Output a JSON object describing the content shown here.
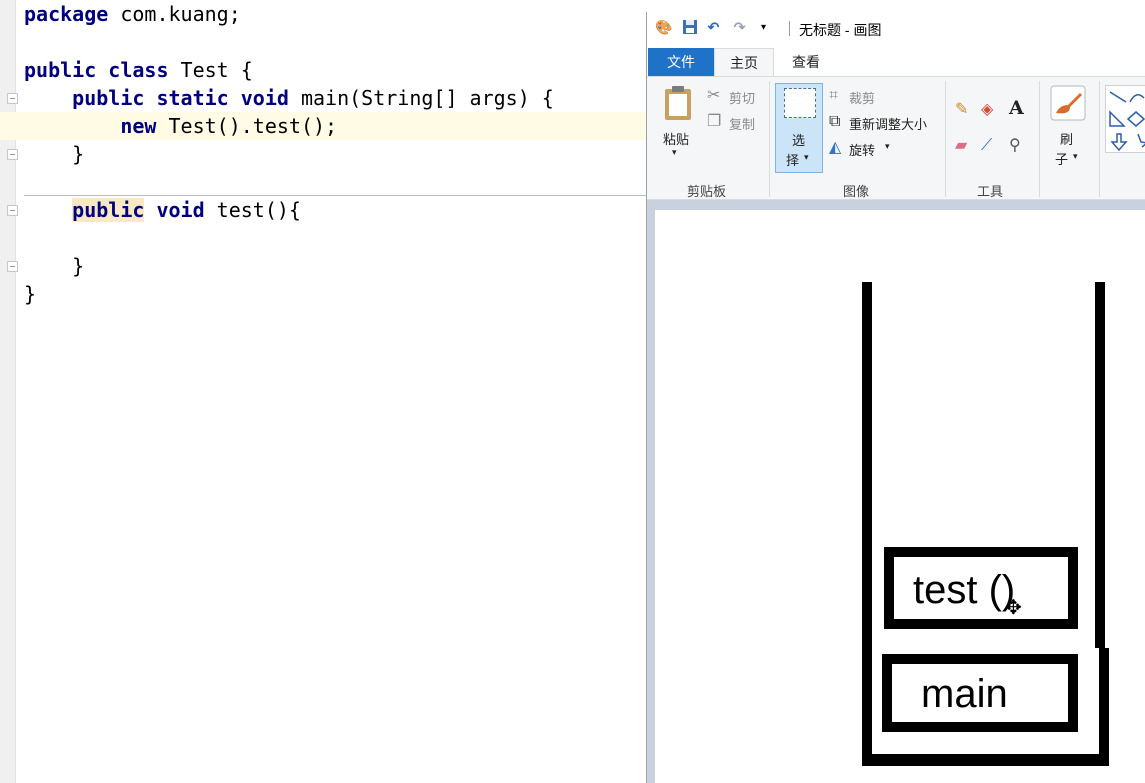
{
  "editor": {
    "lines": [
      [
        {
          "t": "package",
          "k": true
        },
        {
          "t": " com.kuang;"
        }
      ],
      [],
      [
        {
          "t": "public",
          "k": true
        },
        {
          "t": " "
        },
        {
          "t": "class",
          "k": true
        },
        {
          "t": " Test {"
        }
      ],
      [
        {
          "t": "    "
        },
        {
          "t": "public",
          "k": true
        },
        {
          "t": " "
        },
        {
          "t": "static",
          "k": true
        },
        {
          "t": " "
        },
        {
          "t": "void",
          "k": true
        },
        {
          "t": " main(String[] args) {"
        }
      ],
      [
        {
          "t": "        "
        },
        {
          "t": "new",
          "k": true
        },
        {
          "t": " Test().test();"
        }
      ],
      [
        {
          "t": "    }"
        }
      ],
      [],
      [
        {
          "t": "    "
        },
        {
          "t": "public",
          "k": true,
          "h": true
        },
        {
          "t": " "
        },
        {
          "t": "void",
          "k": true
        },
        {
          "t": " test(){"
        }
      ],
      [],
      [
        {
          "t": "    }"
        }
      ],
      [
        {
          "t": "}"
        }
      ]
    ]
  },
  "paint": {
    "title": "无标题 - 画图",
    "tabs": {
      "file": "文件",
      "home": "主页",
      "view": "查看"
    },
    "clipboard": {
      "paste": "粘贴",
      "cut": "剪切",
      "copy": "复制",
      "label": "剪贴板"
    },
    "image": {
      "select_1": "选",
      "select_2": "择",
      "crop": "裁剪",
      "resize": "重新调整大小",
      "rotate": "旋转",
      "label": "图像"
    },
    "tools": {
      "label": "工具",
      "text_tool": "A"
    },
    "brush": {
      "label_1": "刷",
      "label_2": "子"
    },
    "canvas": {
      "frame_top": "test ()",
      "frame_bottom": "main"
    }
  }
}
